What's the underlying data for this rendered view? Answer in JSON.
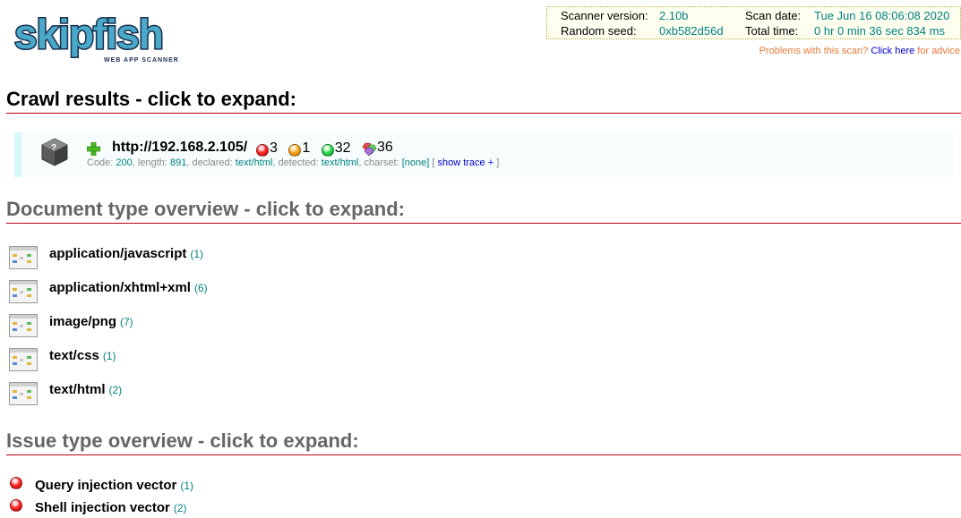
{
  "logo": {
    "text": "skipfish",
    "subtitle": "WEB APP SCANNER"
  },
  "summary": {
    "scanner_version_label": "Scanner version:",
    "scanner_version": "2.10b",
    "random_seed_label": "Random seed:",
    "random_seed": "0xb582d56d",
    "scan_date_label": "Scan date:",
    "scan_date": "Tue Jun 16 08:06:08 2020",
    "total_time_label": "Total time:",
    "total_time": "0 hr 0 min 36 sec 834 ms"
  },
  "advice": {
    "prefix": "Problems with this scan?",
    "link": "Click here",
    "suffix": "for advice"
  },
  "crawl": {
    "heading": "Crawl results - click to expand:",
    "node": {
      "url": "http://192.168.2.105/",
      "high": "3",
      "medium": "1",
      "low": "32",
      "info": "36",
      "code_label": "Code:",
      "code": "200",
      "length_label": ", length:",
      "length": "891",
      "declared_label": ", declared:",
      "declared": "text/html",
      "detected_label": ", detected:",
      "detected": "text/html",
      "charset_label": ", charset:",
      "charset": "[none]",
      "trace_open": "[",
      "trace_link": "show trace +",
      "trace_close": "]"
    }
  },
  "doc_types": {
    "heading": "Document type overview - click to expand:",
    "items": [
      {
        "label": "application/javascript",
        "count": "(1)"
      },
      {
        "label": "application/xhtml+xml",
        "count": "(6)"
      },
      {
        "label": "image/png",
        "count": "(7)"
      },
      {
        "label": "text/css",
        "count": "(1)"
      },
      {
        "label": "text/html",
        "count": "(2)"
      }
    ]
  },
  "issues": {
    "heading": "Issue type overview - click to expand:",
    "items": [
      {
        "label": "Query injection vector",
        "count": "(1)"
      },
      {
        "label": "Shell injection vector",
        "count": "(2)"
      }
    ]
  },
  "colors": {
    "rule": "#b8001e",
    "count": "#008080",
    "link": "#0000cc",
    "advice": "#e87a3a",
    "logo_fill": "#4aa8c8",
    "logo_stroke": "#1a3050"
  }
}
